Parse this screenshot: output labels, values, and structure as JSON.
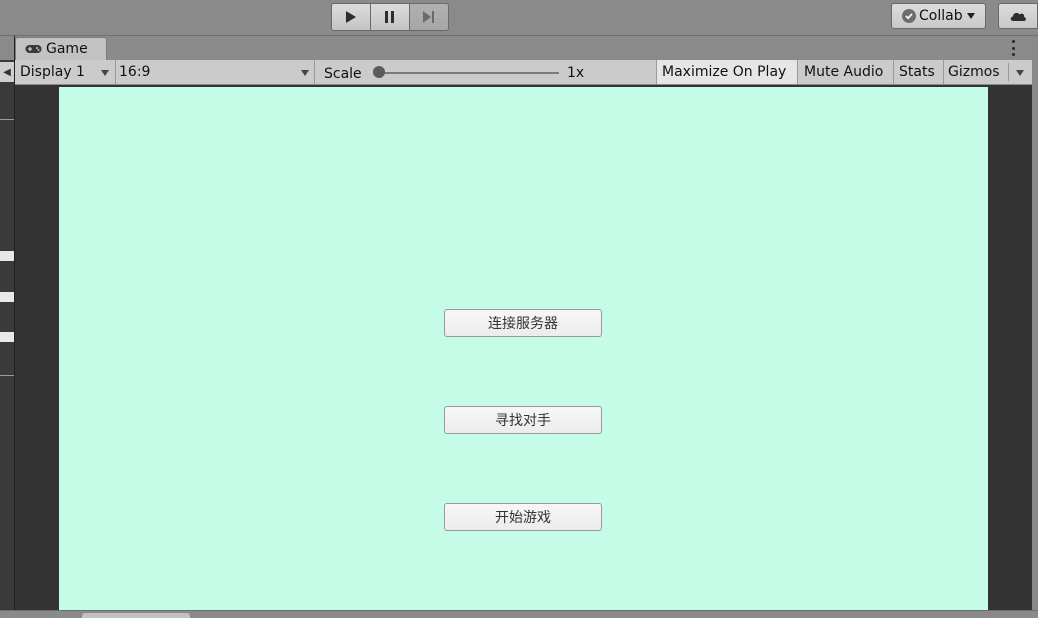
{
  "toolbar": {
    "play_icon": "play-icon",
    "pause_icon": "pause-icon",
    "step_icon": "step-icon",
    "collab_label": "Collab",
    "cloud_icon": "cloud-icon"
  },
  "game_view": {
    "tab_label": "Game",
    "tab_icon": "gamepad-icon",
    "display": "Display 1",
    "aspect": "16:9",
    "scale_label": "Scale",
    "scale_value": "1x",
    "maximize_on_play": "Maximize On Play",
    "mute_audio": "Mute Audio",
    "stats": "Stats",
    "gizmos": "Gizmos",
    "maximize_on_play_active": true
  },
  "game_ui": {
    "buttons": [
      {
        "label": "连接服务器"
      },
      {
        "label": "寻找对手"
      },
      {
        "label": "开始游戏"
      }
    ],
    "background_color": "#c4fce7"
  }
}
